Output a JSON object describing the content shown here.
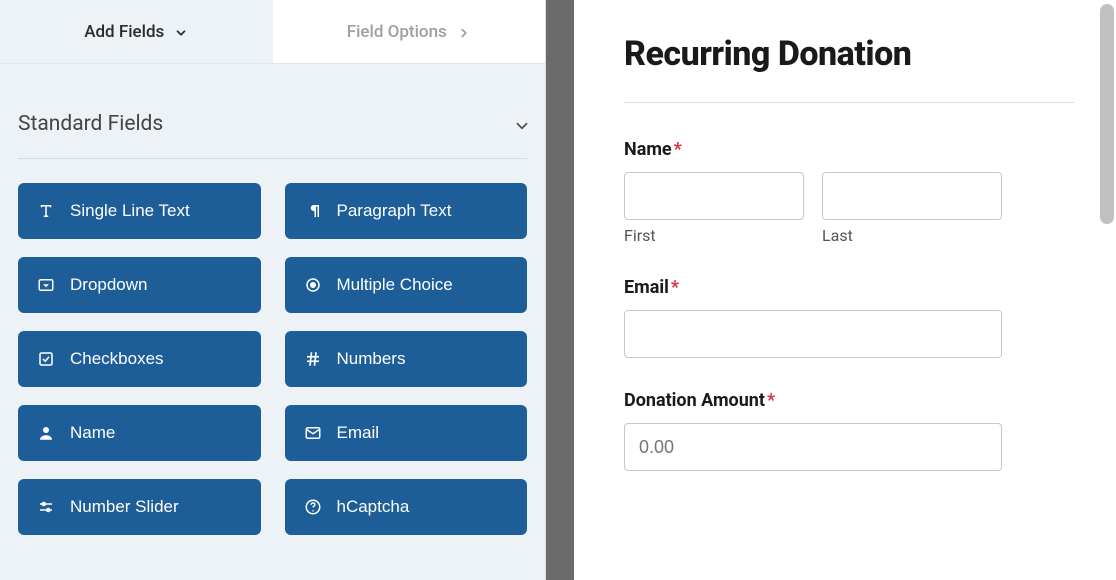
{
  "tabs": {
    "add_fields": "Add Fields",
    "field_options": "Field Options"
  },
  "section": {
    "title": "Standard Fields"
  },
  "fields": [
    {
      "label": "Single Line Text",
      "icon": "text-icon"
    },
    {
      "label": "Paragraph Text",
      "icon": "paragraph-icon"
    },
    {
      "label": "Dropdown",
      "icon": "dropdown-icon"
    },
    {
      "label": "Multiple Choice",
      "icon": "radio-icon"
    },
    {
      "label": "Checkboxes",
      "icon": "checkbox-icon"
    },
    {
      "label": "Numbers",
      "icon": "hash-icon"
    },
    {
      "label": "Name",
      "icon": "user-icon"
    },
    {
      "label": "Email",
      "icon": "envelope-icon"
    },
    {
      "label": "Number Slider",
      "icon": "slider-icon"
    },
    {
      "label": "hCaptcha",
      "icon": "question-icon"
    }
  ],
  "form": {
    "title": "Recurring Donation",
    "name_label": "Name",
    "first_label": "First",
    "last_label": "Last",
    "email_label": "Email",
    "amount_label": "Donation Amount",
    "amount_placeholder": "0.00",
    "required_mark": "*"
  }
}
